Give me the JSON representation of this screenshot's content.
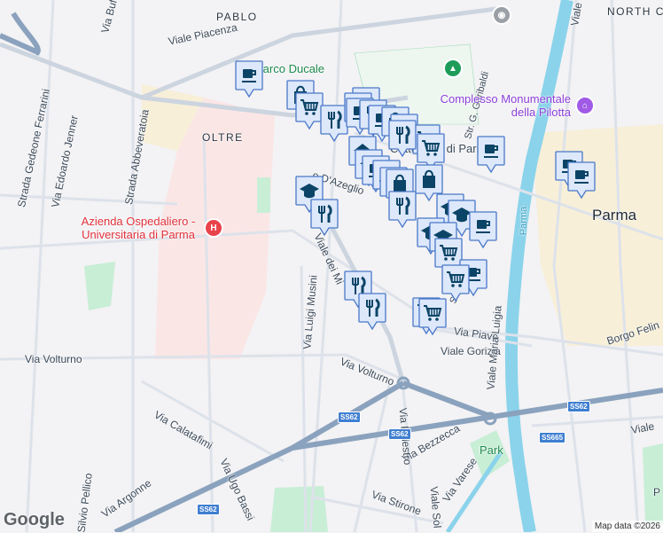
{
  "map": {
    "streets": {
      "pablo": "PABLO",
      "north": "NORTH C",
      "viale_piacenza": "Viale Piacenza",
      "via_buffa": "Via Buffa",
      "viale_top": "Viale P",
      "strada_ferrarini": "Strada Gedeone Ferrarini",
      "via_jenner": "Via Edoardo Jenner",
      "strada_abbeveratoia": "Strada Abbeveratoia",
      "oltretorrente": "OLTRE",
      "viale_dei_mille": "Viale dei Mi",
      "via_musini": "Via Luigi Musini",
      "via_volturno_w": "Via Volturno",
      "via_volturno_e": "Via Volturno",
      "via_calatafimi": "Via Calatafimi",
      "silvio_pellico": "Silvio Pellico",
      "via_argonne": "Via Argonne",
      "via_ugo_bassi": "Via Ugo Bassi",
      "via_stirone": "Via Stirone",
      "via_bezzecca": "Via Bezzecca",
      "via_varese": "Via Varese",
      "via_piave": "Via Piave",
      "viale_gorizia": "Viale Gorizia",
      "viale_maria_luigia": "Viale Maria Luigia",
      "borgo_felino": "Borgo Felin",
      "via_palestro": "Via Palestro",
      "viale_sol": "Viale Sol",
      "viale_e": "Viale",
      "str_garibaldi": "Str. G. Garibaldi",
      "dazeglio": "o D'Azeglio",
      "cattedrale": "Cattedrale di Parma",
      "parma_river": "Parma",
      "str_small": "Str"
    },
    "places": {
      "parco_ducale": "Parco Ducale",
      "pilotta": "Complesso Monumentale della Pilotta",
      "hospital": "Azienda Ospedaliero - Universitaria di Parma",
      "city": "Parma",
      "park": "Park",
      "p_right": "P"
    },
    "shields": [
      "SS62",
      "SS62",
      "SS62",
      "SS62",
      "SS665"
    ],
    "logo": "Google",
    "attribution": "Map data ©2026"
  },
  "colors": {
    "marker_fill": "#dde8fb",
    "marker_border": "#4a78c8",
    "marker_icon": "#0b4466",
    "river": "#8ad3eb",
    "highway": "#8aa2bd"
  }
}
